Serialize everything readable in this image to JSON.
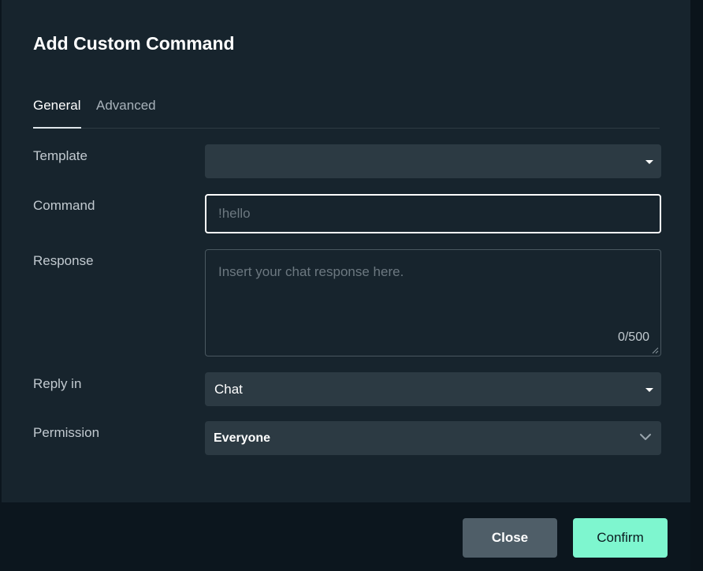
{
  "dialog": {
    "title": "Add Custom Command"
  },
  "tabs": [
    {
      "label": "General",
      "active": true
    },
    {
      "label": "Advanced",
      "active": false
    }
  ],
  "fields": {
    "template": {
      "label": "Template",
      "value": ""
    },
    "command": {
      "label": "Command",
      "value": "",
      "placeholder": "!hello"
    },
    "response": {
      "label": "Response",
      "value": "",
      "placeholder": "Insert your chat response here.",
      "counter": "0/500"
    },
    "reply_in": {
      "label": "Reply in",
      "value": "Chat"
    },
    "permission": {
      "label": "Permission",
      "value": "Everyone"
    }
  },
  "footer": {
    "close_label": "Close",
    "confirm_label": "Confirm"
  },
  "colors": {
    "dialog_bg": "#17242d",
    "footer_bg": "#0c161e",
    "input_bg": "#2c3a43",
    "confirm_accent": "#7ef6cf",
    "close_button": "#4f5e68"
  },
  "icons": {
    "template_dropdown": "caret-down-icon",
    "reply_in_dropdown": "caret-down-icon",
    "permission_dropdown": "chevron-down-icon",
    "response_resize": "resize-handle-icon"
  }
}
